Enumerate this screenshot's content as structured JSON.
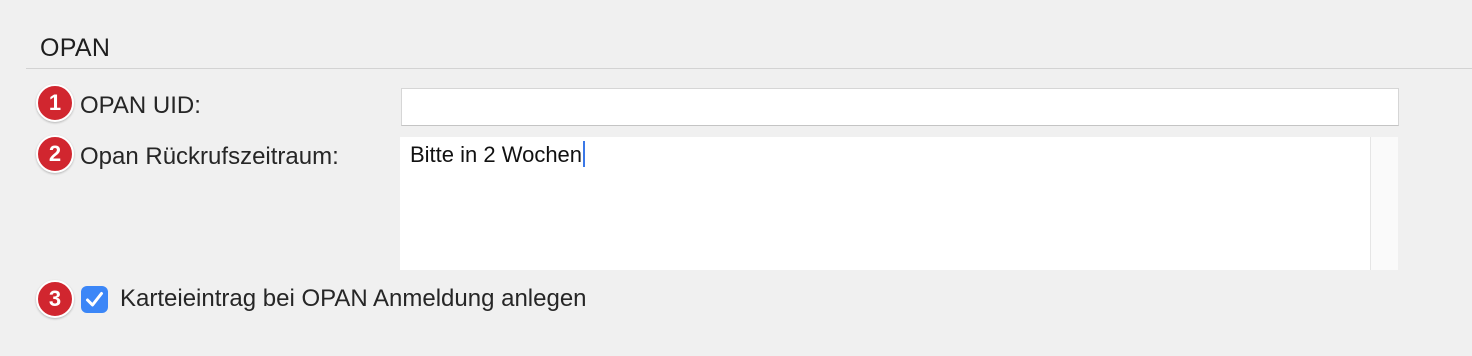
{
  "section": {
    "title": "OPAN"
  },
  "markers": [
    "1",
    "2",
    "3"
  ],
  "fields": {
    "uid": {
      "label": "OPAN UID:",
      "value": ""
    },
    "callback_period": {
      "label": "Opan Rückrufszeitraum:",
      "value": "Bitte in 2 Wochen"
    }
  },
  "checkbox": {
    "label": "Karteieintrag bei OPAN Anmeldung anlegen",
    "checked": true
  },
  "colors": {
    "marker": "#d1262f",
    "checkbox_accent": "#3b86f7",
    "background": "#f0f0f0"
  },
  "icons": {
    "checkbox": "checkmark-icon"
  }
}
